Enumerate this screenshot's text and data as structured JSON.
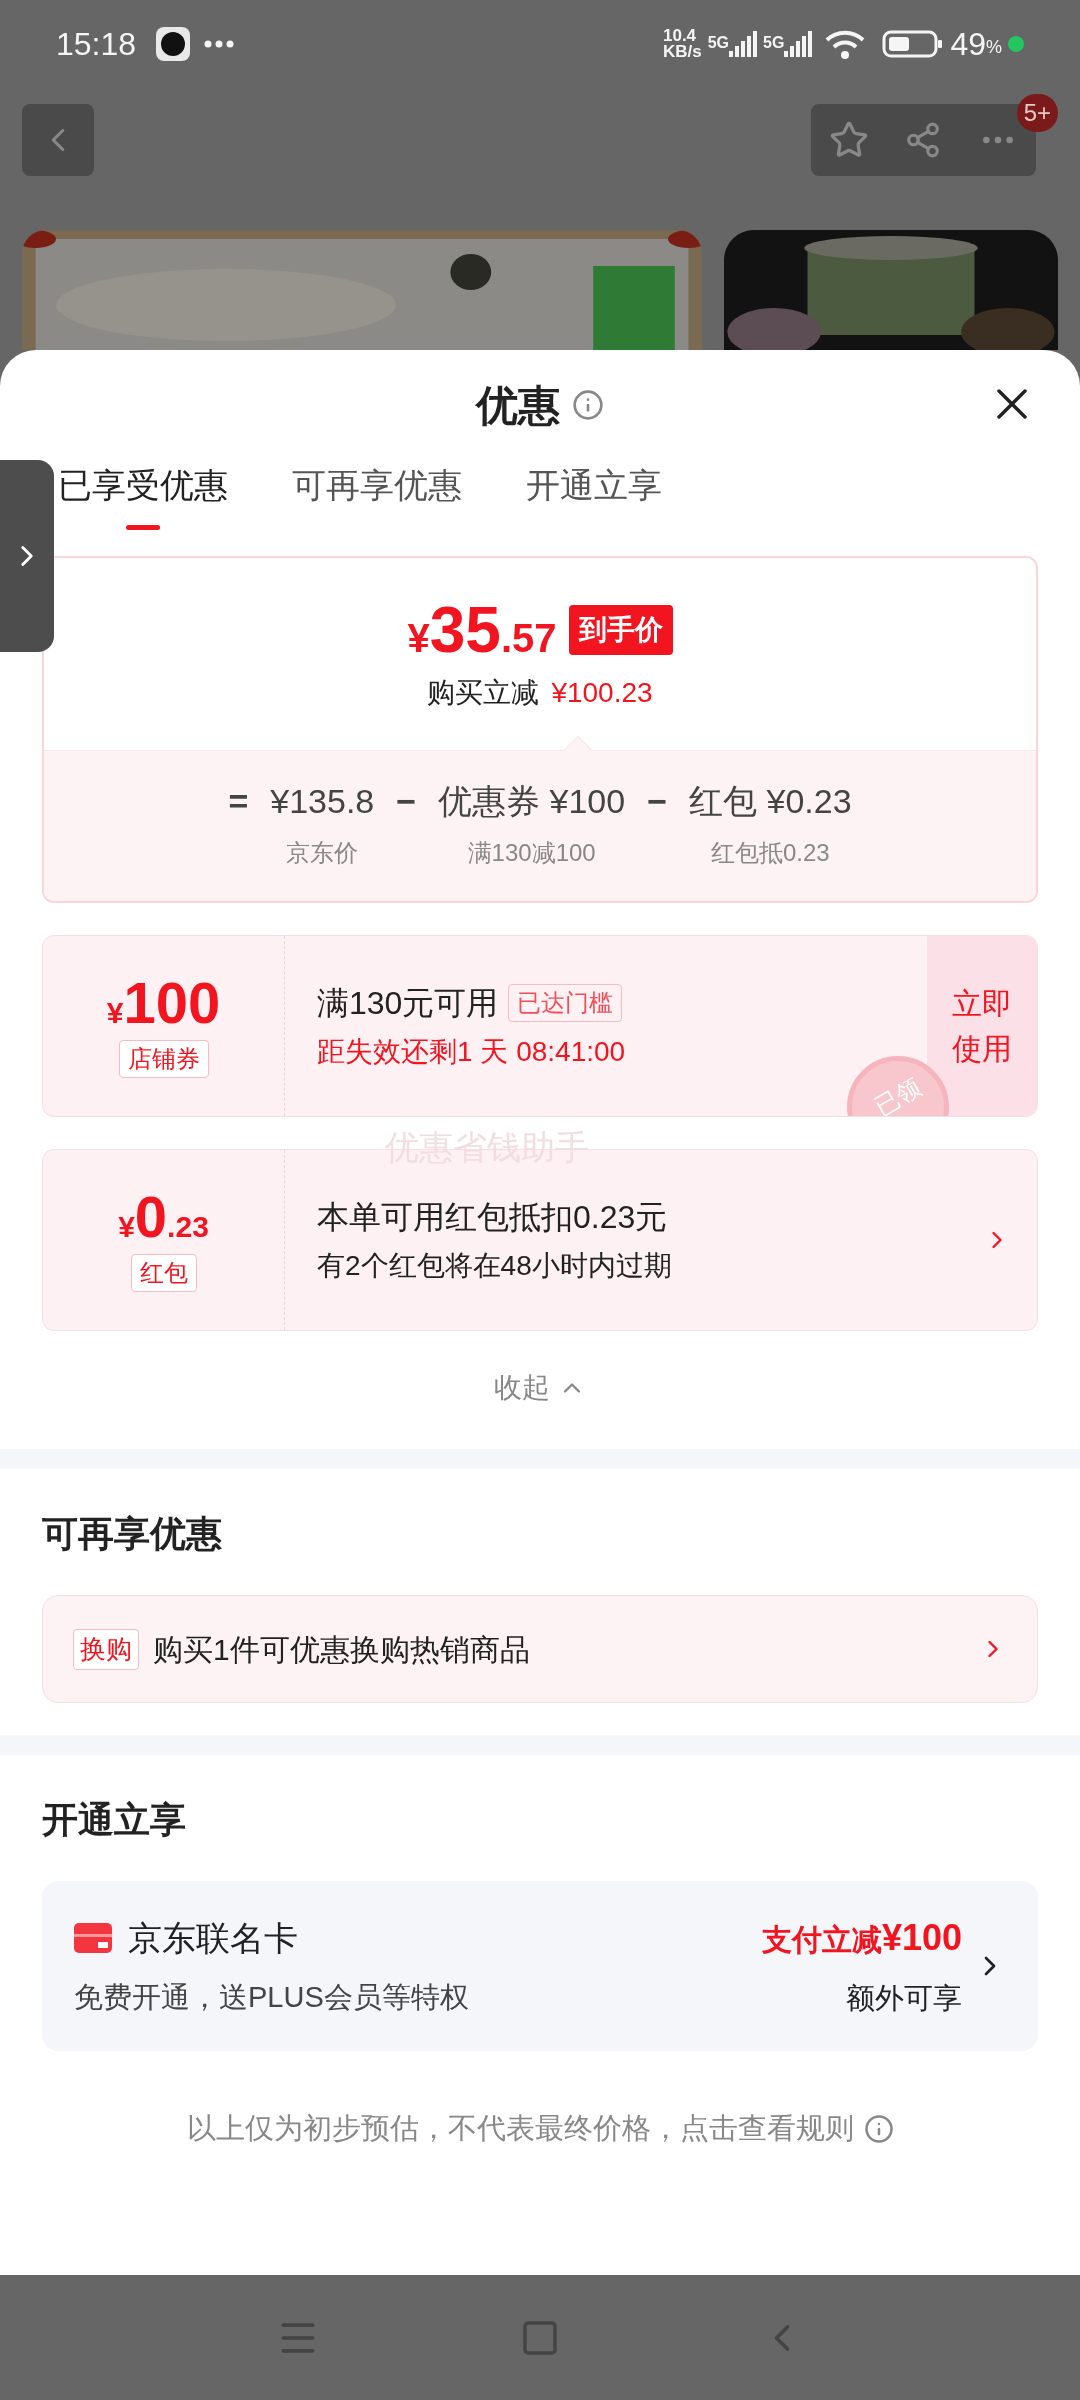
{
  "status_bar": {
    "time": "15:18",
    "net_speed": "10.4",
    "net_unit": "KB/s",
    "signal_1": "5G",
    "signal_2": "5G",
    "battery": "49",
    "battery_unit": "%"
  },
  "top_bar": {
    "badge": "5+"
  },
  "sheet": {
    "title": "优惠",
    "tabs": [
      {
        "label": "已享受优惠",
        "selected": true
      },
      {
        "label": "可再享优惠",
        "selected": false
      },
      {
        "label": "开通立享",
        "selected": false
      }
    ],
    "price_card": {
      "currency": "¥",
      "integer": "35",
      "decimals": ".57",
      "badge": "到手价",
      "saving_label": "购买立减",
      "saving_value": "¥100.23",
      "breakdown": [
        {
          "op": "=",
          "value": "¥135.8",
          "label": "京东价"
        },
        {
          "op": "−",
          "value": "优惠券 ¥100",
          "label": "满130减100"
        },
        {
          "op": "−",
          "value": "红包 ¥0.23",
          "label": "红包抵0.23"
        }
      ]
    },
    "offers": [
      {
        "kind": "coupon",
        "currency": "¥",
        "amount": "100",
        "tag": "店铺券",
        "title": "满130元可用",
        "badge": "已达门槛",
        "subtitle": "距失效还剩1 天 08:41:00",
        "action": [
          "立即",
          "使用"
        ],
        "stamp": "已领"
      },
      {
        "kind": "red_packet",
        "currency": "¥",
        "amount": "0",
        "decimals": ".23",
        "tag": "红包",
        "title": "本单可用红包抵扣0.23元",
        "subtitle": "有2个红包将在48小时内过期"
      }
    ],
    "overlay_text": "优惠省钱助手",
    "collapse": "收起",
    "more_offers": {
      "heading": "可再享优惠",
      "items": [
        {
          "tag": "换购",
          "text": "购买1件可优惠换购热销商品"
        }
      ]
    },
    "open_now": {
      "heading": "开通立享",
      "card": {
        "name": "京东联名卡",
        "desc": "免费开通，送PLUS会员等特权",
        "benefit": "支付立减",
        "benefit_amount": "¥100",
        "note": "额外可享"
      }
    },
    "footer_note": "以上仅为初步预估，不代表最终价格，点击查看规则"
  }
}
